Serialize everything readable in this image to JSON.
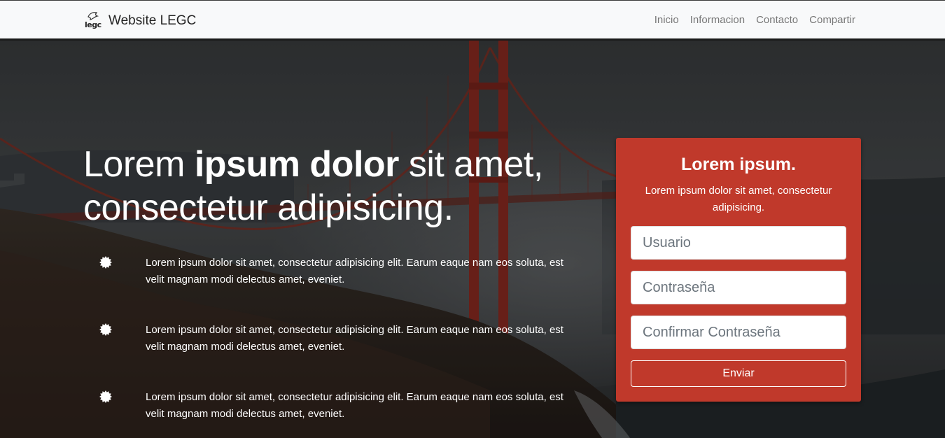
{
  "navbar": {
    "logo_text": "legc",
    "brand": "Website LEGC",
    "links": [
      "Inicio",
      "Informacion",
      "Contacto",
      "Compartir"
    ]
  },
  "hero": {
    "headline_light_1": "Lorem ",
    "headline_bold": "ipsum dolor",
    "headline_light_2": " sit amet, consectetur adipisicing.",
    "features": [
      "Lorem ipsum dolor sit amet, consectetur adipisicing elit. Earum eaque nam eos soluta, est velit magnam modi delectus amet, eveniet.",
      "Lorem ipsum dolor sit amet, consectetur adipisicing elit. Earum eaque nam eos soluta, est velit magnam modi delectus amet, eveniet.",
      "Lorem ipsum dolor sit amet, consectetur adipisicing elit. Earum eaque nam eos soluta, est velit magnam modi delectus amet, eveniet."
    ],
    "feature_icon": "badge-icon"
  },
  "form": {
    "title": "Lorem ipsum.",
    "subtitle": "Lorem ipsum dolor sit amet, consectetur adipisicing.",
    "username_placeholder": "Usuario",
    "password_placeholder": "Contraseña",
    "confirm_placeholder": "Confirmar Contraseña",
    "submit_label": "Enviar"
  },
  "colors": {
    "card_bg": "#c0392b",
    "navbar_bg": "#f8f9fa",
    "nav_link": "#777777"
  }
}
